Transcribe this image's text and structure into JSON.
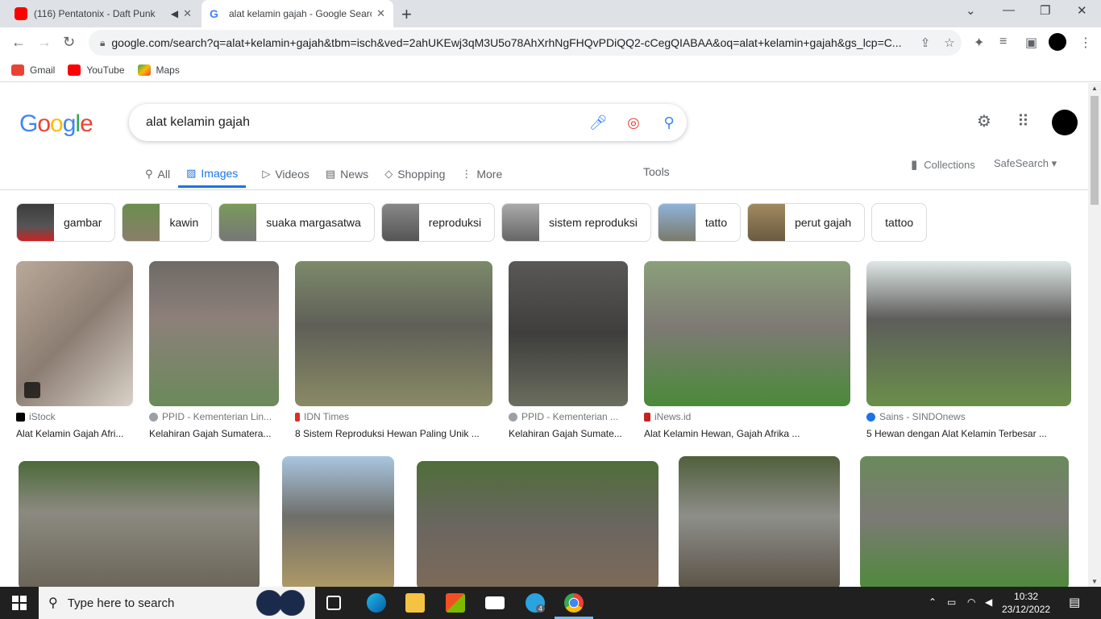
{
  "browser": {
    "tabs": [
      {
        "title": "(116) Pentatonix - Daft Punk",
        "favicon": "youtube-icon",
        "muted_icon": "speaker-icon"
      },
      {
        "title": "alat kelamin gajah - Google Search",
        "favicon": "google-icon"
      }
    ],
    "url": "google.com/search?q=alat+kelamin+gajah&tbm=isch&ved=2ahUKEwj3qM3U5o78AhXrhNgFHQvPDiQQ2-cCegQIABAA&oq=alat+kelamin+gajah&gs_lcp=C...",
    "bookmarks": [
      {
        "label": "Gmail",
        "color": "#EA4335"
      },
      {
        "label": "YouTube",
        "color": "#FF0000"
      },
      {
        "label": "Maps",
        "color": "#34A853"
      }
    ]
  },
  "google": {
    "logo": [
      "G",
      "o",
      "o",
      "g",
      "l",
      "e"
    ],
    "logo_colors": [
      "#4285F4",
      "#EA4335",
      "#FBBC05",
      "#4285F4",
      "#34A853",
      "#EA4335"
    ],
    "query": "alat kelamin gajah",
    "tabs": [
      {
        "label": "All",
        "icon": "search-icon"
      },
      {
        "label": "Images",
        "icon": "image-icon",
        "active": true
      },
      {
        "label": "Videos",
        "icon": "play-icon"
      },
      {
        "label": "News",
        "icon": "news-icon"
      },
      {
        "label": "Shopping",
        "icon": "tag-icon"
      },
      {
        "label": "More",
        "icon": "dots-vertical-icon"
      }
    ],
    "tools": "Tools",
    "collections": "Collections",
    "safesearch": "SafeSearch"
  },
  "chips": [
    {
      "label": "gambar",
      "has_img": true
    },
    {
      "label": "kawin",
      "has_img": true
    },
    {
      "label": "suaka margasatwa",
      "has_img": true
    },
    {
      "label": "reproduksi",
      "has_img": true
    },
    {
      "label": "sistem reproduksi",
      "has_img": true
    },
    {
      "label": "tatto",
      "has_img": true
    },
    {
      "label": "perut gajah",
      "has_img": true
    },
    {
      "label": "tattoo",
      "has_img": false
    }
  ],
  "results_row1": [
    {
      "source": "iStock",
      "title": "Alat Kelamin Gajah Afri...",
      "source_color": "#000000"
    },
    {
      "source": "PPID - Kementerian Lin...",
      "title": "Kelahiran Gajah Sumatera...",
      "source_color": "#5f6368"
    },
    {
      "source": "IDN Times",
      "title": "8 Sistem Reproduksi Hewan Paling Unik ...",
      "source_color": "#d93025"
    },
    {
      "source": "PPID - Kementerian ...",
      "title": "Kelahiran Gajah Sumate...",
      "source_color": "#5f6368"
    },
    {
      "source": "iNews.id",
      "title": "Alat Kelamin Hewan, Gajah Afrika ...",
      "source_color": "#c5221f"
    },
    {
      "source": "Sains - SINDOnews",
      "title": "5 Hewan dengan Alat Kelamin Terbesar ...",
      "source_color": "#1a73e8"
    }
  ],
  "taskbar": {
    "search_placeholder": "Type here to search",
    "time": "10:32",
    "date": "23/12/2022",
    "telegram_badge": "4"
  }
}
